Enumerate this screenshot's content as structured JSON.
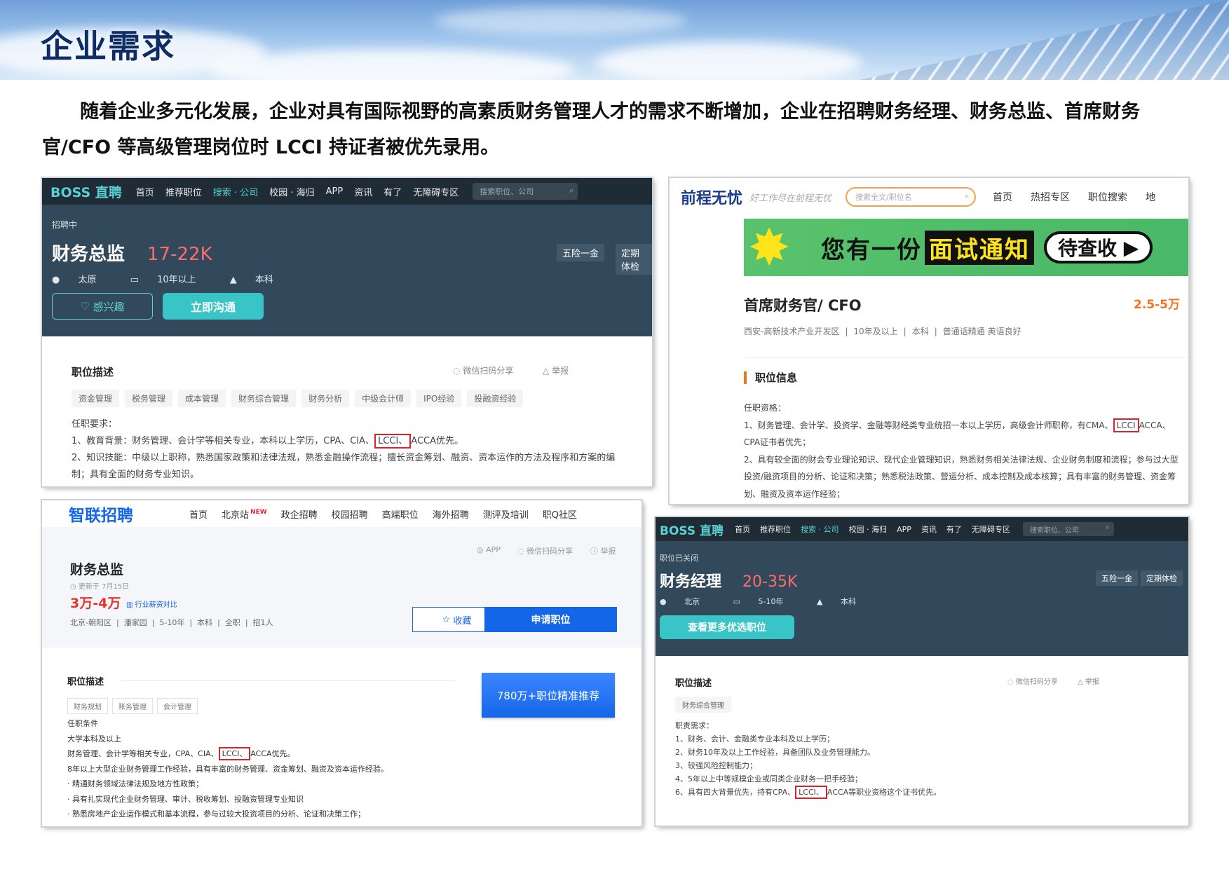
{
  "header": {
    "title": "企业需求"
  },
  "intro": "随着企业多元化发展，企业对具有国际视野的高素质财务管理人才的需求不断增加，企业在招聘财务经理、财务总监、首席财务官/CFO 等高级管理岗位时 LCCI 持证者被优先录用。",
  "boss1": {
    "logo": "BOSS 直聘",
    "nav": [
      "首页",
      "推荐职位",
      "搜索 · 公司",
      "校园 · 海归",
      "APP",
      "资讯",
      "有了",
      "无障碍专区"
    ],
    "search_placeholder": "搜索职位、公司",
    "status": "招聘中",
    "job_title": "财务总监",
    "salary": "17-22K",
    "meta": [
      "太原",
      "10年以上",
      "本科"
    ],
    "benefits": [
      "五险一金",
      "定期体检"
    ],
    "btn_interest": "感兴趣",
    "btn_chat": "立即沟通",
    "section": "职位描述",
    "share": "微信扫码分享",
    "report": "举报",
    "tags": [
      "资金管理",
      "税务管理",
      "成本管理",
      "财务综合管理",
      "财务分析",
      "中级会计师",
      "IPO经验",
      "投融资经验"
    ],
    "req_title": "任职要求：",
    "req1_pre": "1、教育背景：财务管理、会计学等相关专业，本科以上学历，CPA、CIA、",
    "req1_hl": "LCCI、",
    "req1_post": "ACCA优先。",
    "req2": "2、知识技能：中级以上职称，熟悉国家政策和法律法规，熟悉金融操作流程；擅长资金筹划、融资、资本运作的方法及程序和方案的编制；具有全面的财务专业知识。"
  },
  "job51": {
    "logo": "前程无忧",
    "slogan": "好工作尽在前程无忧",
    "search_placeholder": "搜索全文/职位名",
    "nav": [
      "首页",
      "热招专区",
      "职位搜索",
      "地"
    ],
    "ad_pre": "您有一份",
    "ad_hl": "面试通知",
    "ad_pill": "待查收",
    "job_title": "首席财务官/ CFO",
    "salary": "2.5-5万",
    "meta": [
      "西安-高新技术产业开发区",
      "10年及以上",
      "本科",
      "普通话精通 英语良好"
    ],
    "section": "职位信息",
    "req_title": "任职资格：",
    "req1_pre": "1、财务管理、会计学、投资学、金融等财经类专业统招一本以上学历，高级会计师职称，有CMA、",
    "req1_hl": "LCCI",
    "req1_post": "ACCA、CPA证书者优先；",
    "req2": "2、具有较全面的财会专业理论知识、现代企业管理知识，熟悉财务相关法律法规、企业财务制度和流程；参与过大型投资/融资项目的分析、论证和决策；熟悉税法政策、营运分析、成本控制及成本核算；具有丰富的财务管理、资金筹划、融资及资本运作经验；"
  },
  "zhaopin": {
    "logo": "智联招聘",
    "nav": [
      "首页",
      "北京站",
      "政企招聘",
      "校园招聘",
      "高端职位",
      "海外招聘",
      "测评及培训",
      "职Q社区"
    ],
    "new_badge": "NEW",
    "share_app": "APP",
    "share_wechat": "微信扫码分享",
    "report": "举报",
    "job_title": "财务总监",
    "updated": "更新于 7月15日",
    "salary": "3万-4万",
    "compare": "行业薪资对比",
    "meta": [
      "北京-朝阳区",
      "潘家园",
      "5-10年",
      "本科",
      "全职",
      "招1人"
    ],
    "btn_collect": "收藏",
    "btn_apply": "申请职位",
    "section": "职位描述",
    "ad": "780万+职位精准推荐",
    "tags": [
      "财务规划",
      "账务管理",
      "会计管理"
    ],
    "req_title": "任职条件",
    "line1": "大学本科及以上",
    "line2_pre": "财务管理、会计学等相关专业，CPA、CIA、",
    "line2_hl": "LCCI、",
    "line2_post": "ACCA优先。",
    "line3": "8年以上大型企业财务管理工作经验，具有丰富的财务管理、资金筹划、融资及资本运作经验。",
    "line4": "· 精通财务领域法律法规及地方性政策；",
    "line5": "· 具有扎实现代企业财务管理、审计、税收筹划、投融资管理专业知识",
    "line6": "· 熟悉房地产企业运作模式和基本流程，参与过较大投资项目的分析、论证和决策工作；"
  },
  "boss2": {
    "logo": "BOSS 直聘",
    "nav": [
      "首页",
      "推荐职位",
      "搜索 · 公司",
      "校园 · 海归",
      "APP",
      "资讯",
      "有了",
      "无障碍专区"
    ],
    "search_placeholder": "搜索职位、公司",
    "status": "职位已关闭",
    "job_title": "财务经理",
    "salary": "20-35K",
    "meta": [
      "北京",
      "5-10年",
      "本科"
    ],
    "benefits": [
      "五险一金",
      "定期体检"
    ],
    "btn_more": "查看更多优选职位",
    "section": "职位描述",
    "share": "微信扫码分享",
    "report": "举报",
    "tags": [
      "财务综合管理"
    ],
    "req_title": "职责需求：",
    "r1": "1、财务、会计、金融类专业本科及以上学历；",
    "r2": "2、财务10年及以上工作经验，具备团队及业务管理能力。",
    "r3": "3、较强风险控制能力；",
    "r4": "4、5年以上中等规模企业或同类企业财务一把手经验；",
    "r5_pre": "6、具有四大背景优先，持有CPA、",
    "r5_hl": "LCCI、",
    "r5_post": "ACCA等职业资格这个证书优先。"
  }
}
